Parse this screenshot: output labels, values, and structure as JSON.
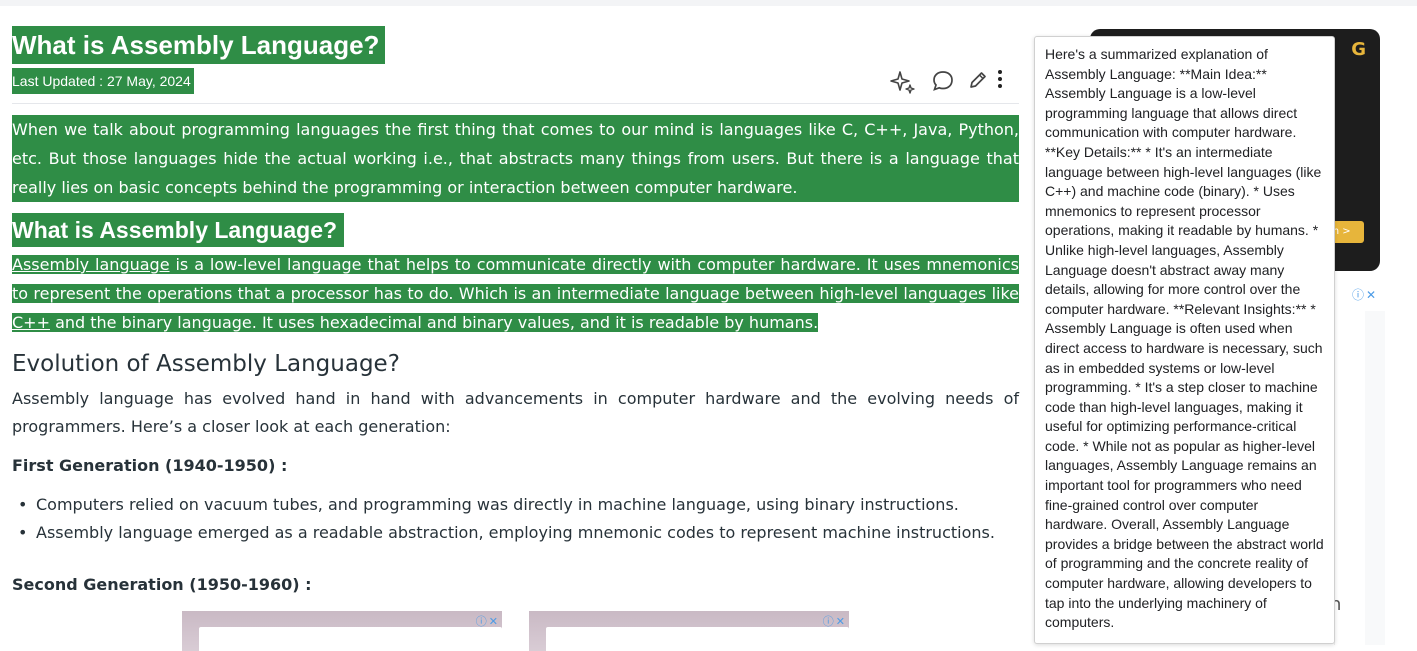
{
  "article": {
    "title": "What is Assembly Language?",
    "last_updated": "Last Updated : 27 May, 2024",
    "intro": "When we talk about programming languages the first thing that comes to our mind is languages like C, C++, Java, Python, etc. But those languages hide the actual working i.e., that abstracts many things from users. But there is a language that really lies on basic concepts behind the programming or interaction between computer hardware.",
    "section1_heading": "What is Assembly Language?",
    "section1_link": "Assembly language",
    "section1_text_a": " is a low-level language that helps to communicate directly with computer hardware. It uses mnemonics to represent the operations that a processor has to do. Which is an intermediate language between high-level languages like ",
    "section1_link2": "C++",
    "section1_text_b": " and the binary language. It uses hexadecimal and binary values, and it is readable by humans.",
    "section2_heading": "Evolution of Assembly Language?",
    "section2_text": "Assembly language has evolved hand in hand with advancements in computer hardware and the evolving needs of programmers. Here’s a closer look at each generation:",
    "gen1_heading": "First Generation (1940-1950) :",
    "gen1_bullets": [
      "Computers relied on vacuum tubes, and programming was directly in machine language, using binary instructions.",
      "Assembly language emerged as a readable abstraction, employing mnemonic codes to represent machine instructions."
    ],
    "gen2_heading": "Second Generation (1950-1960) :"
  },
  "actions": {
    "icons": [
      "sparkle-icon",
      "comment-icon",
      "pencil-icon",
      "more-vertical-icon"
    ]
  },
  "ads": {
    "right_ad_cta": "m >",
    "right_ad_logo": "G",
    "side_ad_char": "n",
    "info_close": "ⓘ✕"
  },
  "popup": {
    "text": "Here's a summarized explanation of Assembly Language: **Main Idea:** Assembly Language is a low-level programming language that allows direct communication with computer hardware. **Key Details:** * It's an intermediate language between high-level languages (like C++) and machine code (binary). * Uses mnemonics to represent processor operations, making it readable by humans. * Unlike high-level languages, Assembly Language doesn't abstract away many details, allowing for more control over the computer hardware. **Relevant Insights:** * Assembly Language is often used when direct access to hardware is necessary, such as in embedded systems or low-level programming. * It's a step closer to machine code than high-level languages, making it useful for optimizing performance-critical code. * While not as popular as higher-level languages, Assembly Language remains an important tool for programmers who need fine-grained control over computer hardware. Overall, Assembly Language provides a bridge between the abstract world of programming and the concrete reality of computer hardware, allowing developers to tap into the underlying machinery of computers."
  },
  "colors": {
    "highlight": "#2f8d46",
    "text": "#273239",
    "ad_gold": "#e7b53b"
  }
}
